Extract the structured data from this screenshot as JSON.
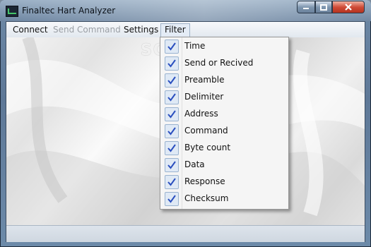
{
  "window": {
    "title": "Finaltec Hart Analyzer"
  },
  "titlebar_buttons": {
    "min": "minimize",
    "max": "maximize",
    "close": "close"
  },
  "menubar": {
    "items": [
      {
        "label": "Connect",
        "state": "enabled"
      },
      {
        "label": "Send Command",
        "state": "disabled"
      },
      {
        "label": "Settings",
        "state": "enabled"
      },
      {
        "label": "Filter",
        "state": "active"
      }
    ]
  },
  "watermark": "SOFTPEDIA",
  "filter_menu": {
    "items": [
      {
        "label": "Time",
        "checked": true
      },
      {
        "label": "Send or Recived",
        "checked": true
      },
      {
        "label": "Preamble",
        "checked": true
      },
      {
        "label": "Delimiter",
        "checked": true
      },
      {
        "label": "Address",
        "checked": true
      },
      {
        "label": "Command",
        "checked": true
      },
      {
        "label": "Byte count",
        "checked": true
      },
      {
        "label": "Data",
        "checked": true
      },
      {
        "label": "Response",
        "checked": true
      },
      {
        "label": "Checksum",
        "checked": true
      }
    ]
  },
  "colors": {
    "check_accent": "#2a4fbf",
    "close_button": "#c8432f"
  }
}
